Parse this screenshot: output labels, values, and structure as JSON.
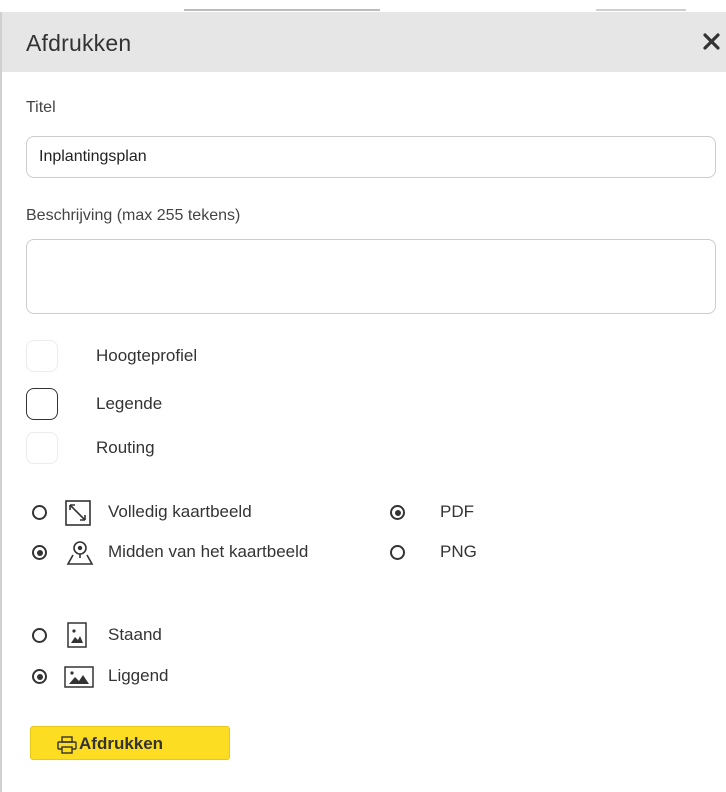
{
  "dialog": {
    "title": "Afdrukken",
    "close_icon": "close-icon"
  },
  "form": {
    "title_label": "Titel",
    "title_value": "Inplantingsplan",
    "description_label": "Beschrijving (max 255 tekens)",
    "description_value": ""
  },
  "checkboxes": [
    {
      "label": "Hoogteprofiel",
      "checked": false
    },
    {
      "label": "Legende",
      "checked": false
    },
    {
      "label": "Routing",
      "checked": false
    }
  ],
  "extent_options": [
    {
      "label": "Volledig kaartbeeld",
      "icon": "full-extent-icon",
      "checked": false
    },
    {
      "label": "Midden van het kaartbeeld",
      "icon": "map-center-icon",
      "checked": true
    }
  ],
  "format_options": [
    {
      "label": "PDF",
      "checked": true
    },
    {
      "label": "PNG",
      "checked": false
    }
  ],
  "orientation_options": [
    {
      "label": "Staand",
      "icon": "portrait-icon",
      "checked": false
    },
    {
      "label": "Liggend",
      "icon": "landscape-icon",
      "checked": true
    }
  ],
  "print_button": {
    "label": "Afdrukken",
    "icon": "printer-icon",
    "color": "#fddd21"
  }
}
